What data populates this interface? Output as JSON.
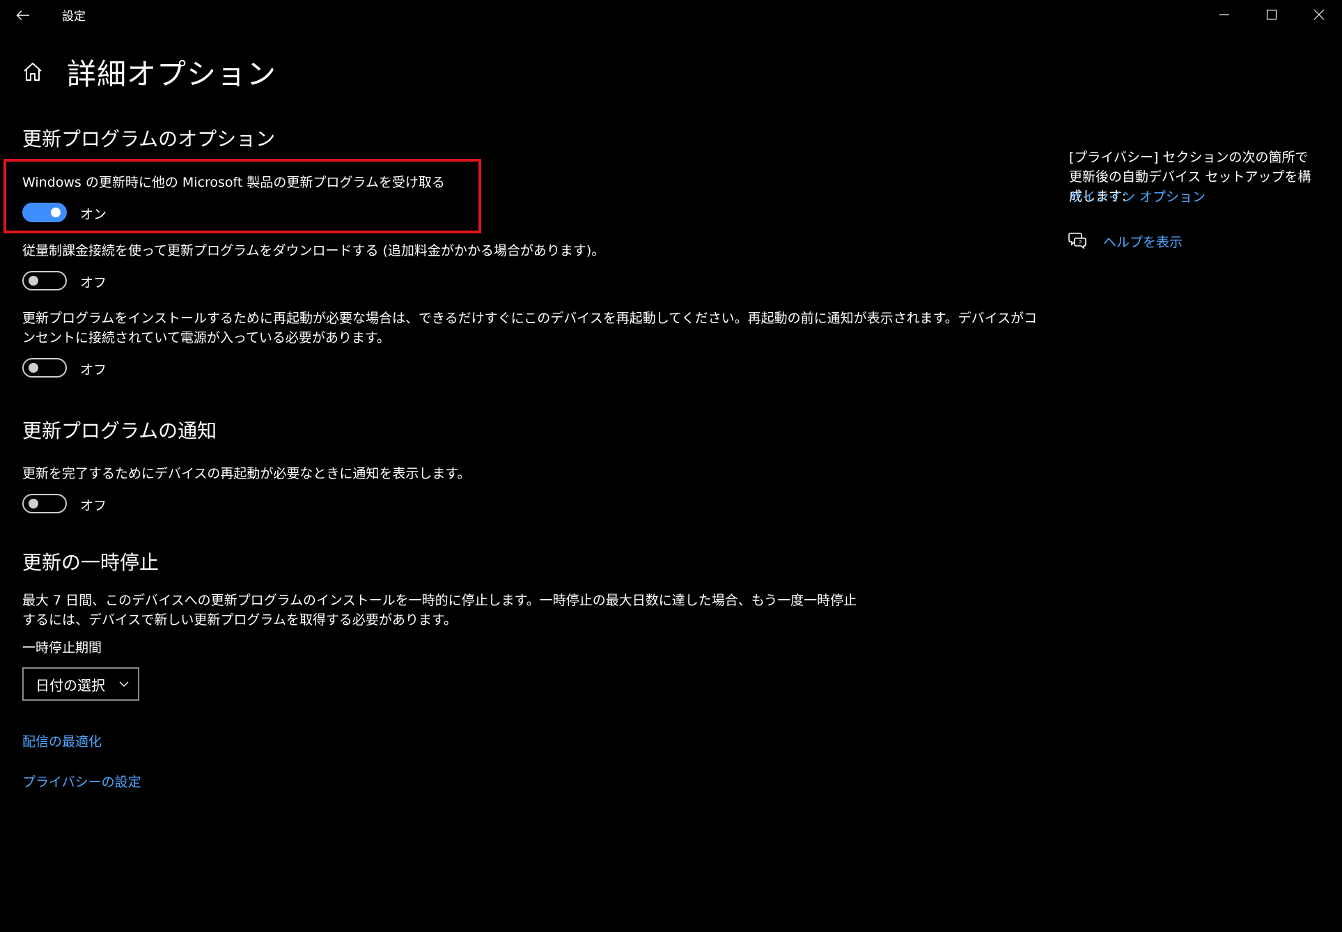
{
  "window": {
    "title": "設定"
  },
  "page": {
    "title": "詳細オプション"
  },
  "update_options": {
    "heading": "更新プログラムのオプション",
    "items": [
      {
        "label": "Windows の更新時に他の Microsoft 製品の更新プログラムを受け取る",
        "state": "オン",
        "on": true
      },
      {
        "label": "従量制課金接続を使って更新プログラムをダウンロードする (追加料金がかかる場合があります)。",
        "state": "オフ",
        "on": false
      },
      {
        "label": "更新プログラムをインストールするために再起動が必要な場合は、できるだけすぐにこのデバイスを再起動してください。再起動の前に通知が表示されます。デバイスがコンセントに接続されていて電源が入っている必要があります。",
        "state": "オフ",
        "on": false
      }
    ]
  },
  "notifications": {
    "heading": "更新プログラムの通知",
    "items": [
      {
        "label": "更新を完了するためにデバイスの再起動が必要なときに通知を表示します。",
        "state": "オフ",
        "on": false
      }
    ]
  },
  "pause": {
    "heading": "更新の一時停止",
    "description": "最大 7 日間、このデバイスへの更新プログラムのインストールを一時的に停止します。一時停止の最大日数に達した場合、もう一度一時停止するには、デバイスで新しい更新プログラムを取得する必要があります。",
    "period_label": "一時停止期間",
    "dropdown_value": "日付の選択"
  },
  "links": {
    "delivery_optimization": "配信の最適化",
    "privacy_settings": "プライバシーの設定"
  },
  "sidebar": {
    "description": "[プライバシー] セクションの次の箇所で更新後の自動デバイス セットアップを構成します:",
    "signin_link": "サインイン オプション",
    "help_link": "ヘルプを表示"
  },
  "colors": {
    "background": "#000000",
    "accent": "#3e8eff",
    "link": "#4fa8ff",
    "highlight": "#e0141e"
  },
  "icons": {
    "back": "back-arrow-icon",
    "minimize": "minimize-icon",
    "maximize": "maximize-icon",
    "close": "close-icon",
    "home": "home-icon",
    "chevron": "chevron-down-icon",
    "help": "help-chat-icon"
  }
}
